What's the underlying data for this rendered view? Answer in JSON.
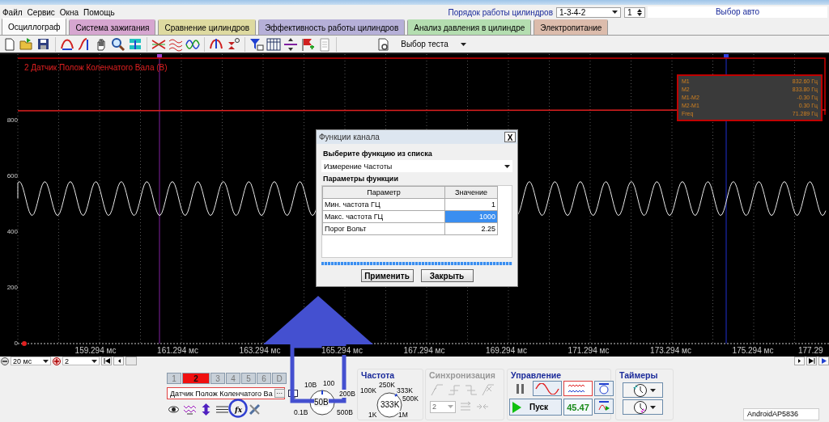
{
  "menu": [
    "Файл",
    "Сервис",
    "Окна",
    "Помощь"
  ],
  "cylinder_order": {
    "label": "Порядок работы цилиндров",
    "value": "1-3-4-2",
    "spinner_value": "1"
  },
  "car_select": {
    "label": "Выбор авто"
  },
  "tabs": [
    {
      "label": "Осциллограф",
      "selected": true,
      "color": "#ffffff"
    },
    {
      "label": "Система зажигания",
      "selected": false,
      "color": "#d6a6d0"
    },
    {
      "label": "Сравнение цилиндров",
      "selected": false,
      "color": "#dedaa0"
    },
    {
      "label": "Эффективность работы цилиндров",
      "selected": false,
      "color": "#b6b0d8"
    },
    {
      "label": "Анализ давления в цилиндре",
      "selected": false,
      "color": "#b4deb0"
    },
    {
      "label": "Электропитание",
      "selected": false,
      "color": "#dcbcac"
    }
  ],
  "toolbar": {
    "test_select": "Выбор теста"
  },
  "scope": {
    "channel_title": "2 Датчик Полож Коленчатого Вала (В)",
    "y_ticks": [
      "800",
      "600",
      "400",
      "200",
      "0"
    ],
    "x_ticks": [
      "159.294 мс",
      "161.294 мс",
      "163.294 мс",
      "165.294 мс",
      "167.294 мс",
      "169.294 мс",
      "171.294 мс",
      "173.294 мс",
      "175.294 мс",
      "177.29"
    ],
    "measurements": [
      {
        "name": "M1",
        "value": "832.60 Гц"
      },
      {
        "name": "M2",
        "value": "833.80 Гц"
      },
      {
        "name": "M1-M2",
        "value": "-0.30 Гц"
      },
      {
        "name": "M2-M1",
        "value": "0.30 Гц"
      },
      {
        "name": "Freq",
        "value": "71.289 Гц"
      }
    ]
  },
  "dialog": {
    "title": "Функции канала",
    "close": "X",
    "function_label": "Выберите функцию из списка",
    "function_value": "Измерение Частоты",
    "params_label": "Параметры функции",
    "columns": [
      "Параметр",
      "Значение"
    ],
    "rows": [
      {
        "name": "Мин. частота ГЦ",
        "value": "1",
        "selected": false
      },
      {
        "name": "Макс. частота ГЦ",
        "value": "1000",
        "selected": true
      },
      {
        "name": "Порог Вольт",
        "value": "2.25",
        "selected": false
      }
    ],
    "buttons": [
      "Применить",
      "Закрыть"
    ]
  },
  "timebase": {
    "scale": "20 мс",
    "channel": "2"
  },
  "channels": {
    "buttons": [
      {
        "label": "1",
        "selected": false
      },
      {
        "label": "2",
        "selected": true
      },
      {
        "label": "3",
        "selected": false
      },
      {
        "label": "4",
        "selected": false
      },
      {
        "label": "5",
        "selected": false
      },
      {
        "label": "6",
        "selected": false
      },
      {
        "label": "D",
        "selected": false
      }
    ],
    "sensor": "Датчик Полож Коленчатого Ва",
    "sensor_button": "···",
    "function_icon": "fx"
  },
  "voltage": {
    "ticks": [
      "10В",
      "100",
      "200В",
      "0.1В",
      "500В"
    ],
    "value": "50В"
  },
  "frequency": {
    "title": "Частота",
    "ticks": [
      "100K",
      "250K",
      "333K",
      "500K",
      "1K",
      "1M"
    ],
    "value": "333K"
  },
  "sync": {
    "title": "Синхронизация",
    "channel": "2"
  },
  "control": {
    "title": "Управление",
    "start": "Пуск",
    "reading": "45.47"
  },
  "timers": {
    "title": "Таймеры"
  },
  "status": {
    "network": "AndroidAP5836"
  }
}
